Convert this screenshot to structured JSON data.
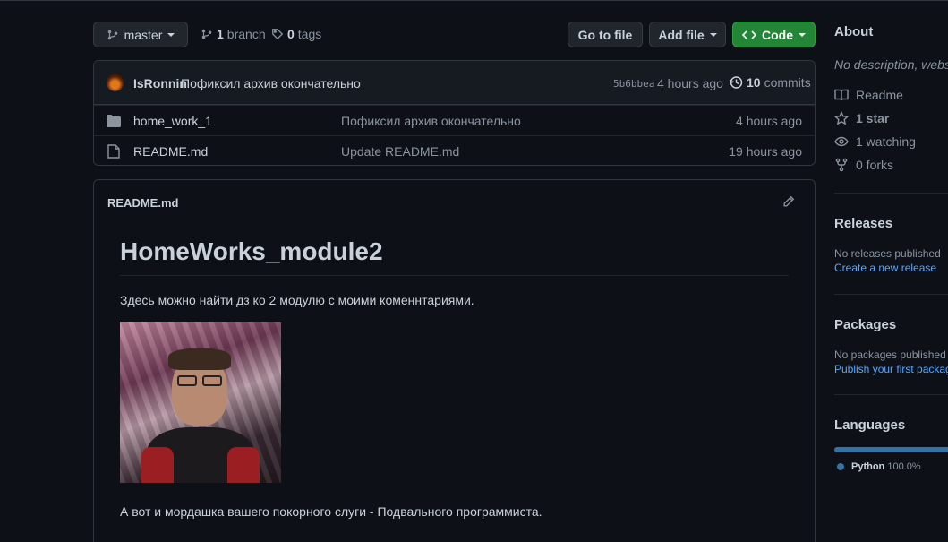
{
  "toolbar": {
    "branch_name": "master",
    "branch_count": "1",
    "branch_label": "branch",
    "tag_count": "0",
    "tag_label": "tags",
    "go_to_file": "Go to file",
    "add_file": "Add file",
    "code": "Code"
  },
  "commit": {
    "author": "IsRonnin",
    "message": "Пофиксил архив окончательно",
    "sha": "5b6bbea",
    "time": "4 hours ago",
    "commits_count": "10",
    "commits_label": "commits"
  },
  "files": [
    {
      "type": "folder",
      "name": "home_work_1",
      "message": "Пофиксил архив окончательно",
      "time": "4 hours ago"
    },
    {
      "type": "file",
      "name": "README.md",
      "message": "Update README.md",
      "time": "19 hours ago"
    }
  ],
  "readme": {
    "filename": "README.md",
    "heading": "HomeWorks_module2",
    "intro": "Здесь можно найти дз ко 2 модулю с моими коменнтариями.",
    "caption": "А вот и мордашка вашего покорного слуги - Подвального программиста."
  },
  "sidebar": {
    "about_title": "About",
    "description": "No description, website",
    "readme": "Readme",
    "stars": "1 star",
    "watching": "1 watching",
    "forks": "0 forks",
    "releases_title": "Releases",
    "releases_empty": "No releases published",
    "releases_link": "Create a new release",
    "packages_title": "Packages",
    "packages_empty": "No packages published",
    "packages_link": "Publish your first package",
    "languages_title": "Languages",
    "language_name": "Python",
    "language_percent": "100.0%"
  },
  "colors": {
    "python": "#3572a5",
    "green_button": "#238636",
    "link": "#58a6ff"
  }
}
